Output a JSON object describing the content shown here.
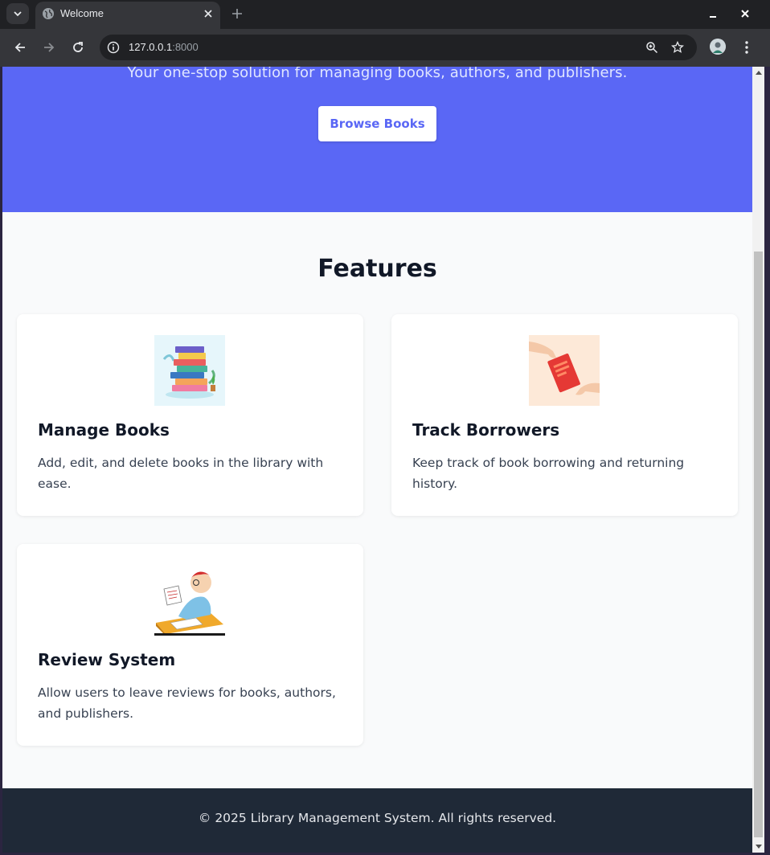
{
  "browser": {
    "tab_title": "Welcome",
    "url_host": "127.0.0.1",
    "url_port": ":8000"
  },
  "hero": {
    "subtitle": "Your one-stop solution for managing books, authors, and publishers.",
    "cta_label": "Browse Books"
  },
  "features": {
    "title": "Features",
    "cards": [
      {
        "title": "Manage Books",
        "description": "Add, edit, and delete books in the library with ease.",
        "image": "stack-of-books-illustration"
      },
      {
        "title": "Track Borrowers",
        "description": "Keep track of book borrowing and returning history.",
        "image": "hands-passing-book-illustration"
      },
      {
        "title": "Review System",
        "description": "Allow users to leave reviews for books, authors, and publishers.",
        "image": "man-reviewing-paper-illustration"
      }
    ]
  },
  "footer": {
    "text": "© 2025 Library Management System. All rights reserved."
  },
  "colors": {
    "hero_bg": "#5a67f5",
    "footer_bg": "#1f2937",
    "page_bg": "#f9fafb",
    "heading": "#111827"
  }
}
